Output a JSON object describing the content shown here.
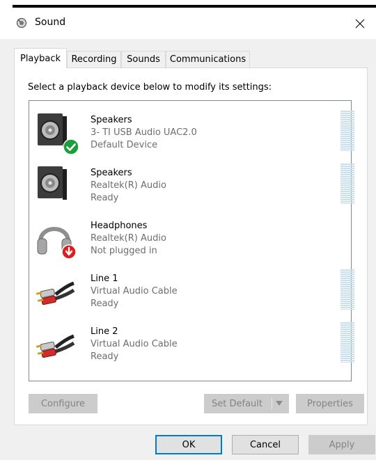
{
  "window": {
    "title": "Sound",
    "icon": "speaker-icon",
    "close_glyph": "✕"
  },
  "tabs": [
    {
      "label": "Playback",
      "active": true
    },
    {
      "label": "Recording",
      "active": false
    },
    {
      "label": "Sounds",
      "active": false
    },
    {
      "label": "Communications",
      "active": false
    }
  ],
  "instruction": "Select a playback device below to modify its settings:",
  "devices": [
    {
      "name": "Speakers",
      "description": "3- TI USB Audio UAC2.0",
      "status": "Default Device",
      "icon": "speaker-icon",
      "badge": "green-check-icon",
      "meter": true
    },
    {
      "name": "Speakers",
      "description": "Realtek(R) Audio",
      "status": "Ready",
      "icon": "speaker-icon",
      "meter": true
    },
    {
      "name": "Headphones",
      "description": "Realtek(R) Audio",
      "status": "Not plugged in",
      "icon": "headphones-icon",
      "badge": "red-down-arrow-icon",
      "meter": false
    },
    {
      "name": "Line 1",
      "description": "Virtual Audio Cable",
      "status": "Ready",
      "icon": "rca-cable-icon",
      "meter": true
    },
    {
      "name": "Line 2",
      "description": "Virtual Audio Cable",
      "status": "Ready",
      "icon": "rca-cable-icon",
      "meter": true
    }
  ],
  "buttons": {
    "configure": "Configure",
    "set_default": "Set Default",
    "properties": "Properties",
    "ok": "OK",
    "cancel": "Cancel",
    "apply": "Apply"
  },
  "colors": {
    "accent": "#0078d7",
    "meter": "#c9e1ef",
    "check_green": "#1e9e3b",
    "alert_red": "#d9201e"
  }
}
